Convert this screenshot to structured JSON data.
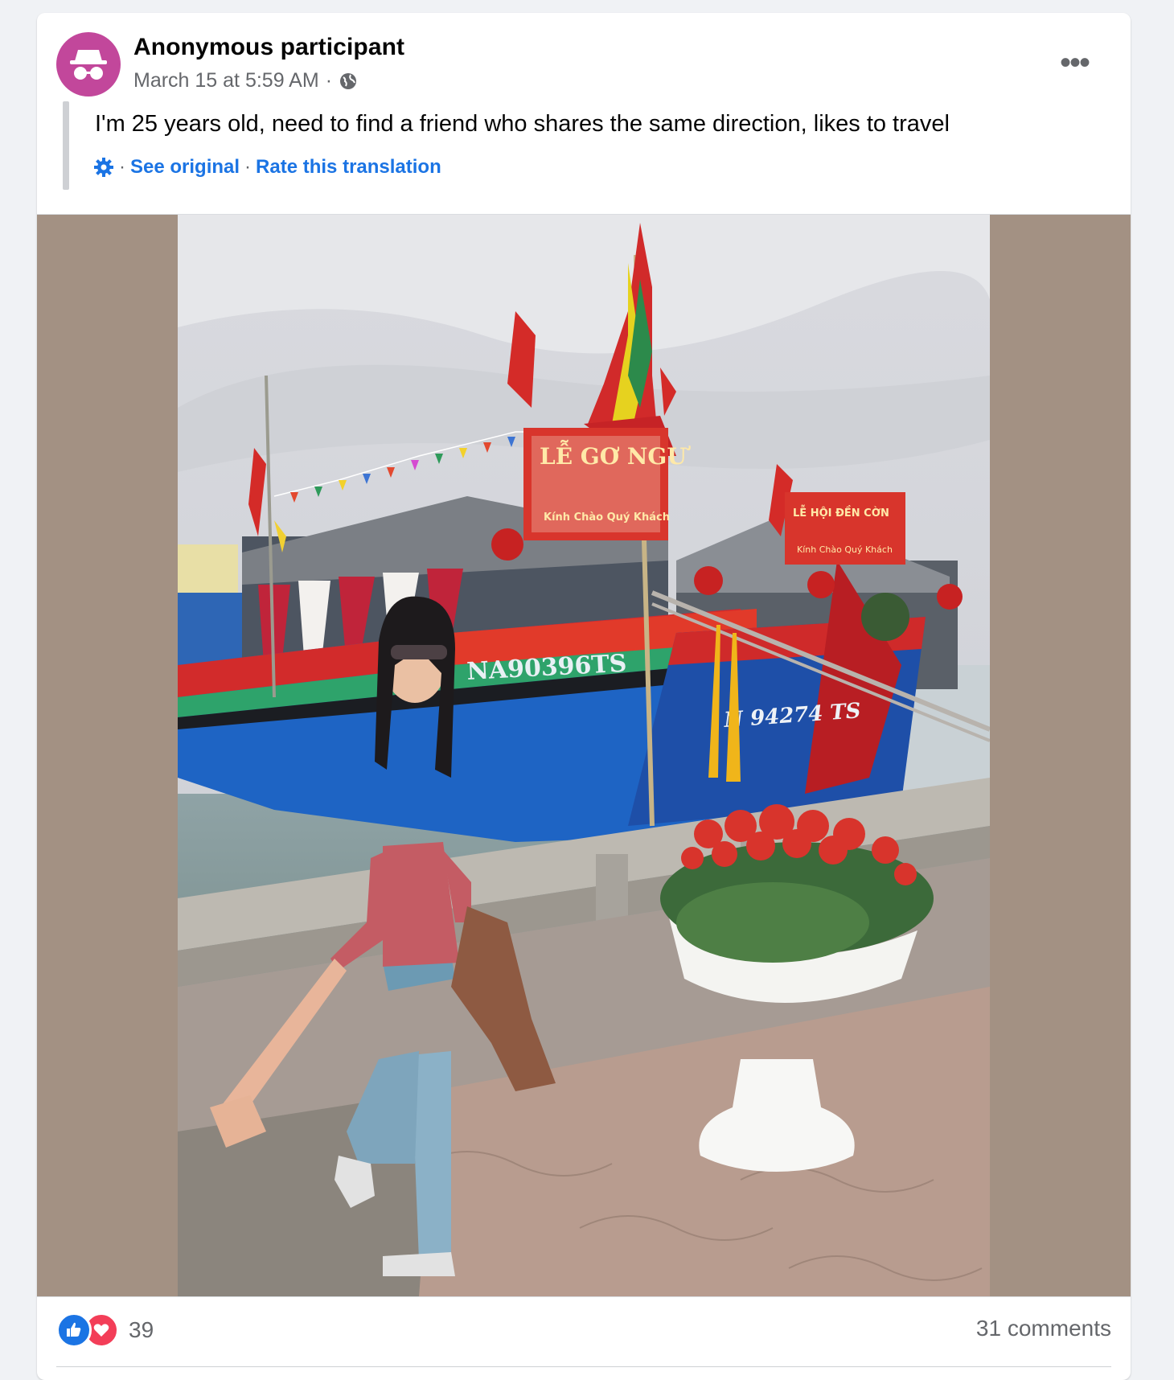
{
  "post": {
    "author": "Anonymous participant",
    "timestamp": "March 15 at 5:59 AM",
    "separator": "·",
    "audience_icon": "globe-icon",
    "avatar_icon": "incognito-icon",
    "avatar_color": "#c2479b",
    "text": "I'm 25 years old, need to find a friend who shares the same direction, likes to travel",
    "translation": {
      "settings_icon": "gear-icon",
      "see_original": "See original",
      "rate": "Rate this translation",
      "separator": "·"
    },
    "more_icon": "more-options-icon",
    "more_label": "•••"
  },
  "photo": {
    "boat_numbers": [
      "NA90396TS",
      "N 94274 TS"
    ],
    "banners": [
      "LỄ GƠ NGƯ",
      "Kính Chào Quý Khách",
      "LỄ HỘI ĐỀN CỜN"
    ],
    "background_color": "#a39183"
  },
  "footer": {
    "reactions": [
      "like-icon",
      "love-icon"
    ],
    "reaction_count": "39",
    "comments": "31 comments"
  },
  "colors": {
    "accent": "#1b74e4",
    "secondary_text": "#65676b",
    "love": "#f33e58"
  }
}
